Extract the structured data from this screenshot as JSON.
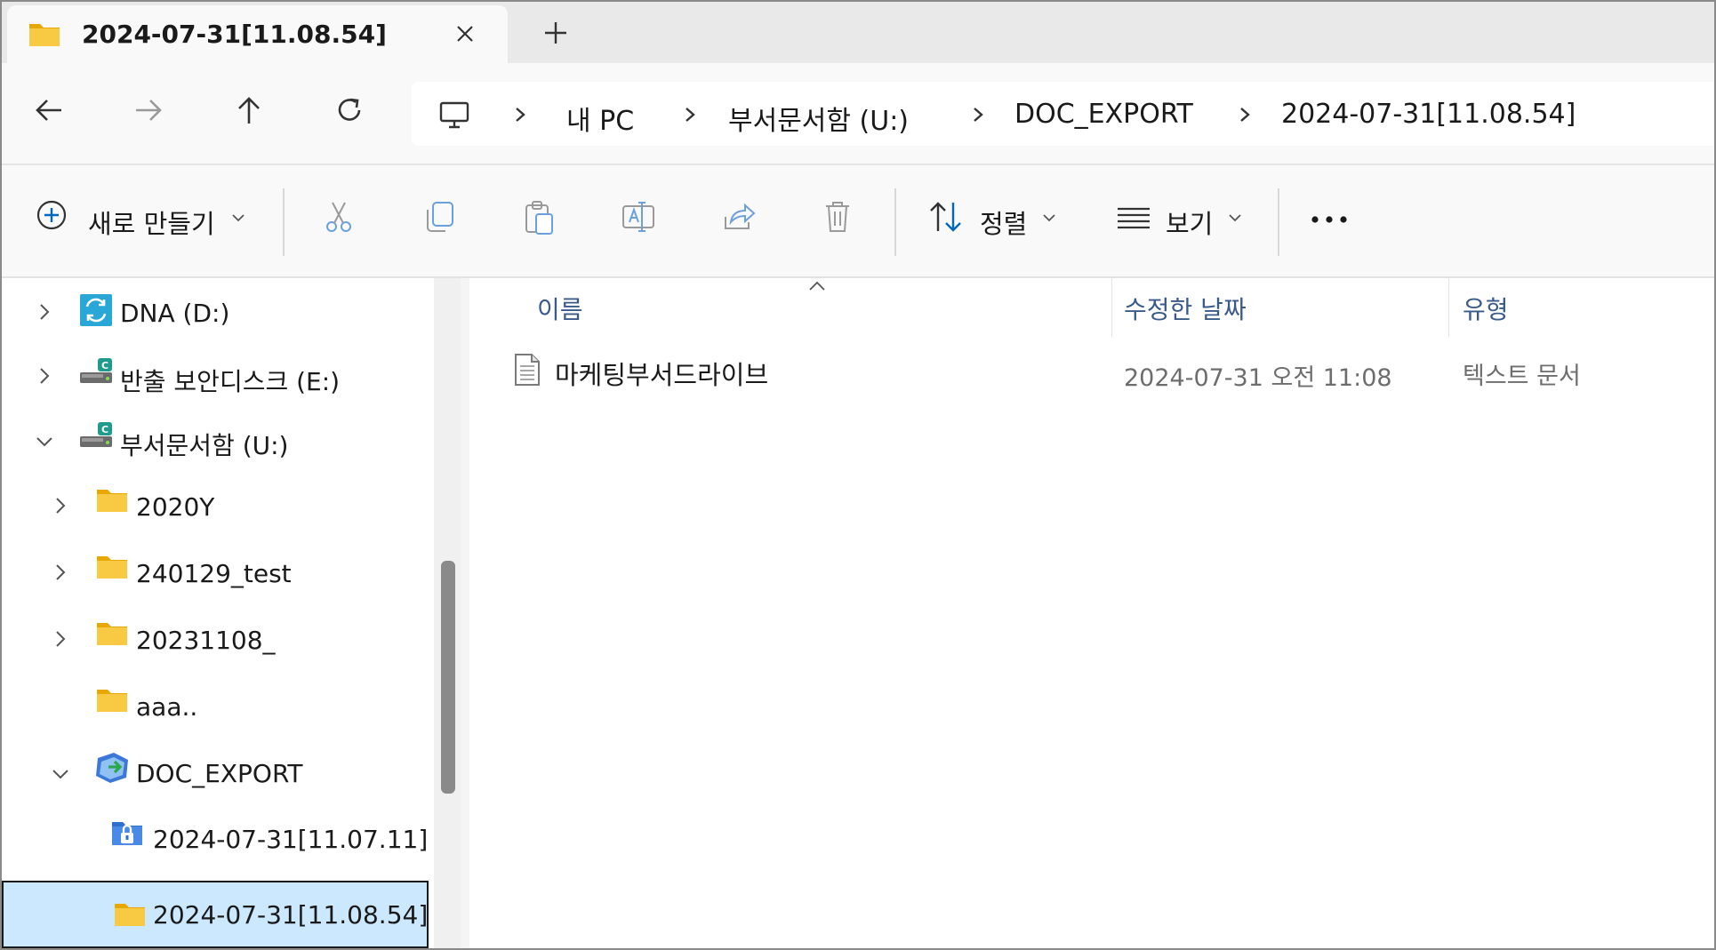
{
  "tab": {
    "title": "2024-07-31[11.08.54]"
  },
  "breadcrumb": [
    "내 PC",
    "부서문서함 (U:)",
    "DOC_EXPORT",
    "2024-07-31[11.08.54]"
  ],
  "toolbar": {
    "new_label": "새로 만들기",
    "sort_label": "정렬",
    "view_label": "보기"
  },
  "sidebar": {
    "items": [
      {
        "label": "DNA (D:)"
      },
      {
        "label": "반출 보안디스크 (E:)"
      },
      {
        "label": "부서문서함 (U:)"
      },
      {
        "label": "2020Y"
      },
      {
        "label": "240129_test"
      },
      {
        "label": "20231108_"
      },
      {
        "label": "aaa.."
      },
      {
        "label": "DOC_EXPORT"
      },
      {
        "label": "2024-07-31[11.07.11]"
      },
      {
        "label": "2024-07-31[11.08.54]"
      }
    ]
  },
  "columns": {
    "name": "이름",
    "date": "수정한 날짜",
    "type": "유형"
  },
  "files": [
    {
      "name": "마케팅부서드라이브",
      "date": "2024-07-31 오전 11:08",
      "type": "텍스트 문서",
      "icon": "text-file-icon"
    }
  ],
  "colors": {
    "selected_bg": "#cce8ff",
    "accent": "#0067c0",
    "folder": "#f8c943"
  }
}
